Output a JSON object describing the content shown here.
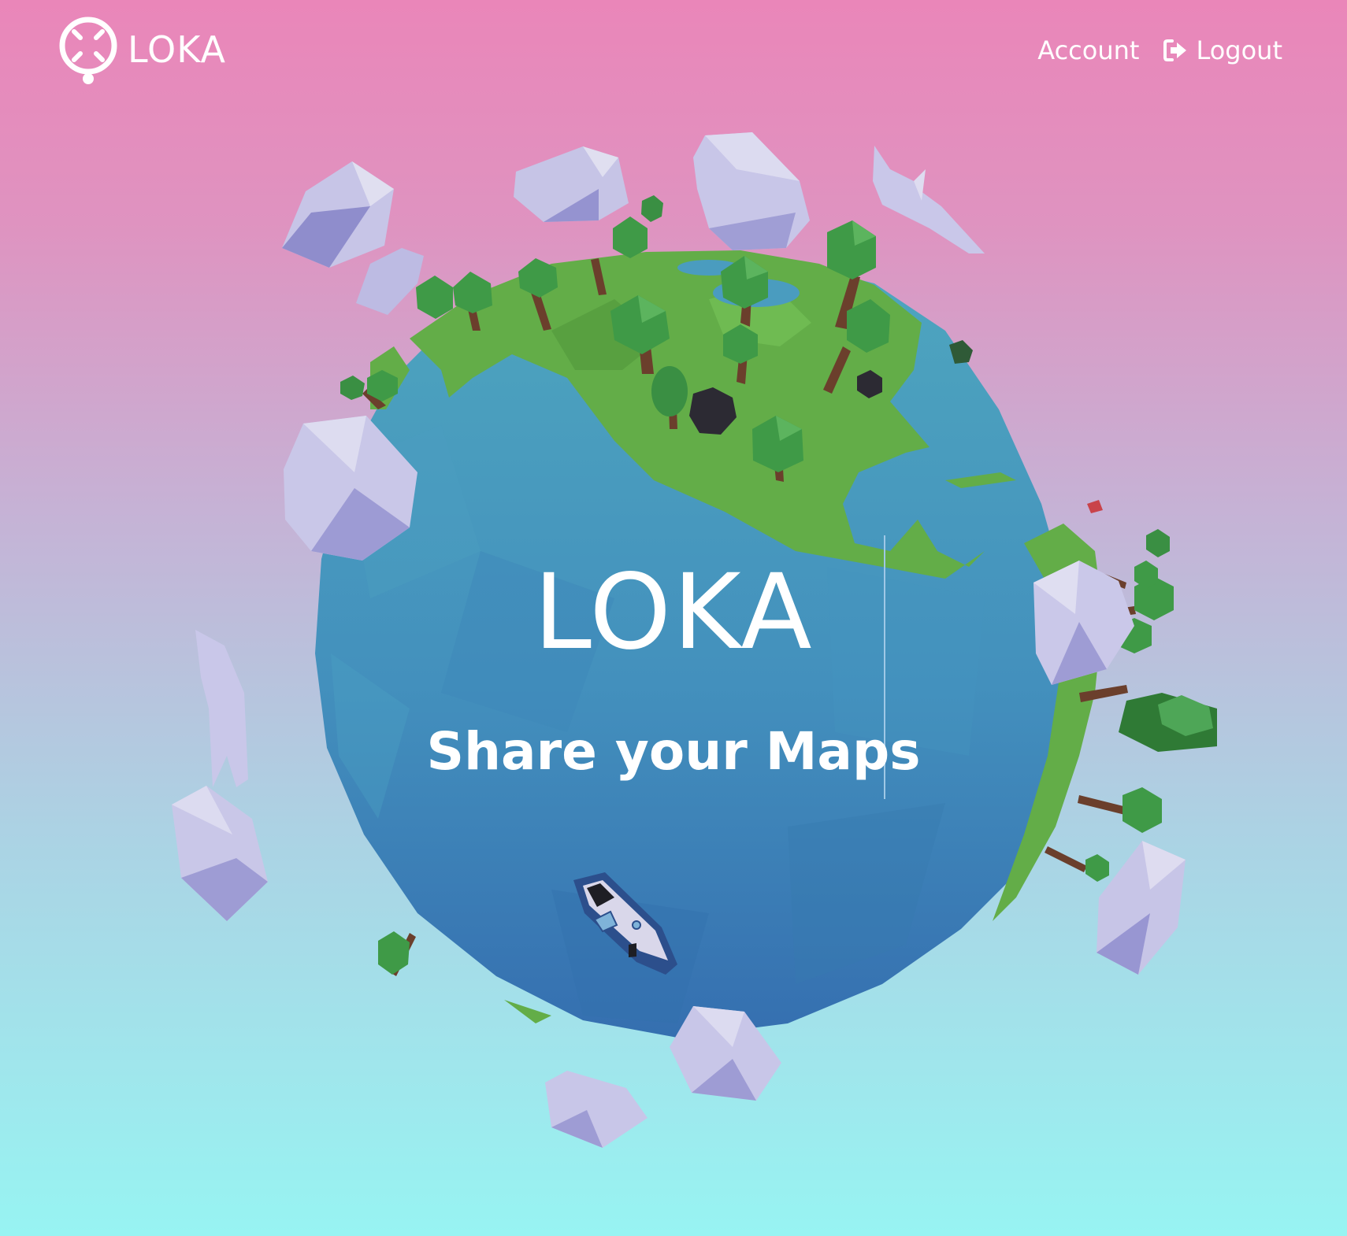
{
  "navbar": {
    "brand_name": "LOKA",
    "brand_logo_icon": "compass-ring-icon",
    "links": [
      {
        "label": "Account",
        "icon": null
      },
      {
        "label": "Logout",
        "icon": "sign-out-icon"
      }
    ]
  },
  "hero": {
    "title": "LOKA",
    "subtitle": "Share your Maps"
  },
  "scene": {
    "description_icon": "low-poly-planet-illustration",
    "colors": {
      "background_top": "#ea86b9",
      "background_bottom": "#97f4f2",
      "ocean": "#3f8fc0",
      "land": "#63ad48",
      "foliage": "#3f9a47",
      "trunk": "#6b3f2c",
      "cloud": "#b7b4e0",
      "rock": "#2c2a33"
    }
  }
}
